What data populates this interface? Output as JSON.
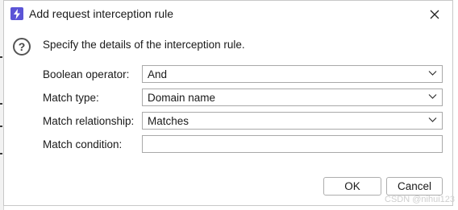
{
  "dialog": {
    "title": "Add request interception rule",
    "instruction": "Specify the details of the interception rule."
  },
  "fields": {
    "boolean_operator": {
      "label": "Boolean operator:",
      "value": "And"
    },
    "match_type": {
      "label": "Match type:",
      "value": "Domain name"
    },
    "match_relationship": {
      "label": "Match relationship:",
      "value": "Matches"
    },
    "match_condition": {
      "label": "Match condition:",
      "value": ""
    }
  },
  "buttons": {
    "ok": "OK",
    "cancel": "Cancel"
  },
  "watermark": "CSDN @nihui123",
  "icons": {
    "app": "lightning-icon",
    "close": "close-icon",
    "info": "question-circle-icon",
    "dropdown": "chevron-down-icon"
  },
  "colors": {
    "app_icon_bg": "#5b54d6"
  }
}
